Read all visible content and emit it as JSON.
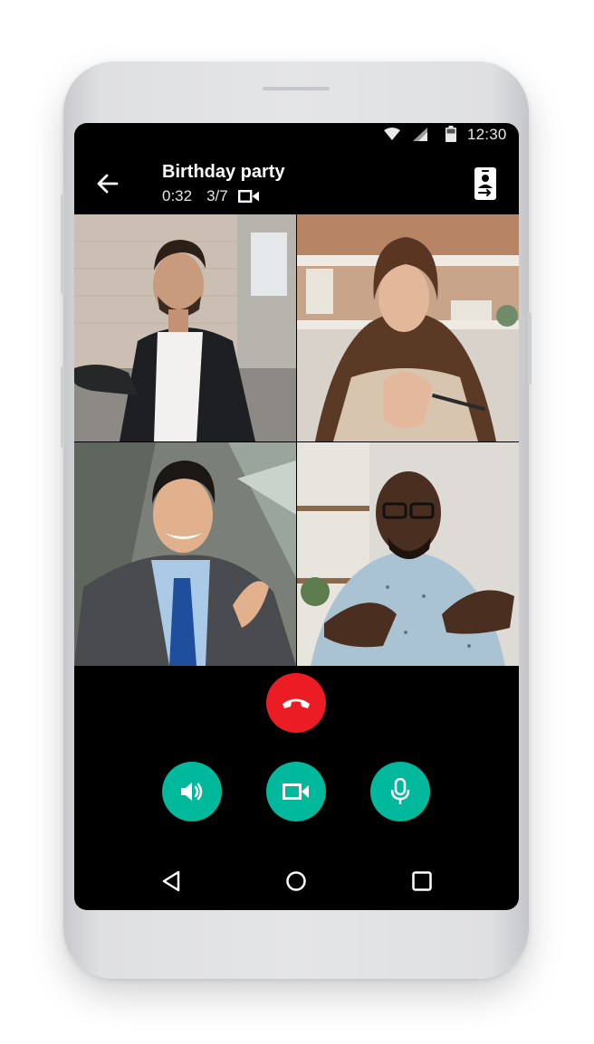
{
  "status_bar": {
    "time": "12:30",
    "icons": [
      "wifi-icon",
      "cellular-signal-icon",
      "battery-icon"
    ]
  },
  "call": {
    "title": "Birthday party",
    "duration": "0:32",
    "participants": "3/7",
    "type_icon": "video-camera-icon"
  },
  "header_actions": {
    "back_icon": "arrow-left-icon",
    "switch_icon": "switch-camera-icon"
  },
  "participants_tiles": [
    {
      "id": "participant-1"
    },
    {
      "id": "participant-2"
    },
    {
      "id": "participant-3"
    },
    {
      "id": "participant-4"
    }
  ],
  "controls": {
    "end_call_icon": "phone-hangup-icon",
    "speaker_icon": "speaker-icon",
    "camera_icon": "video-camera-icon",
    "mic_icon": "microphone-icon"
  },
  "nav": {
    "back_icon": "triangle-back-icon",
    "home_icon": "circle-home-icon",
    "recents_icon": "square-recents-icon"
  },
  "colors": {
    "end_call": "#ec1c24",
    "control_accent": "#00b89c",
    "screen_background": "#000000"
  }
}
